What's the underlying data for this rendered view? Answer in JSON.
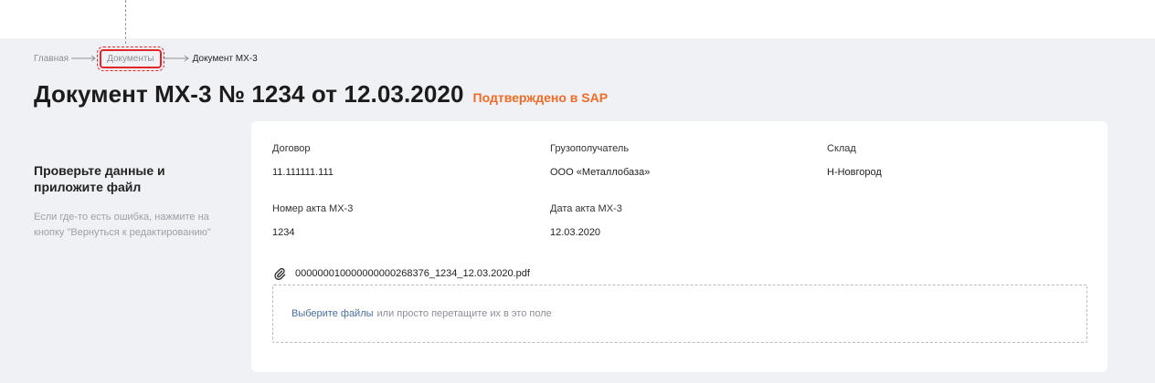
{
  "breadcrumb": {
    "home": "Главная",
    "documents": "Документы",
    "current": "Документ МХ-3"
  },
  "header": {
    "title": "Документ МХ-3 № 1234 от 12.03.2020",
    "status": "Подтверждено в SAP"
  },
  "left": {
    "heading": "Проверьте данные и приложите файл",
    "hint": "Если где-то есть ошибка, нажмите на кнопку \"Вернуться к редактированию\""
  },
  "fields": {
    "contract": {
      "label": "Договор",
      "value": "11.111111.111"
    },
    "consignee": {
      "label": "Грузополучатель",
      "value": "ООО «Металлобаза»"
    },
    "warehouse": {
      "label": "Склад",
      "value": "Н-Новгород"
    },
    "act_number": {
      "label": "Номер акта МХ-3",
      "value": "1234"
    },
    "act_date": {
      "label": "Дата акта МХ-3",
      "value": "12.03.2020"
    }
  },
  "attachment": {
    "filename": "000000010000000000268376_1234_12.03.2020.pdf",
    "icon": "paperclip-icon"
  },
  "dropzone": {
    "link_text": "Выберите файлы",
    "rest_text": "или просто перетащите их в это поле"
  },
  "colors": {
    "status": "#f06b26",
    "highlight": "#e0252b",
    "link": "#4a6fa0",
    "background": "#f0f1f5"
  }
}
